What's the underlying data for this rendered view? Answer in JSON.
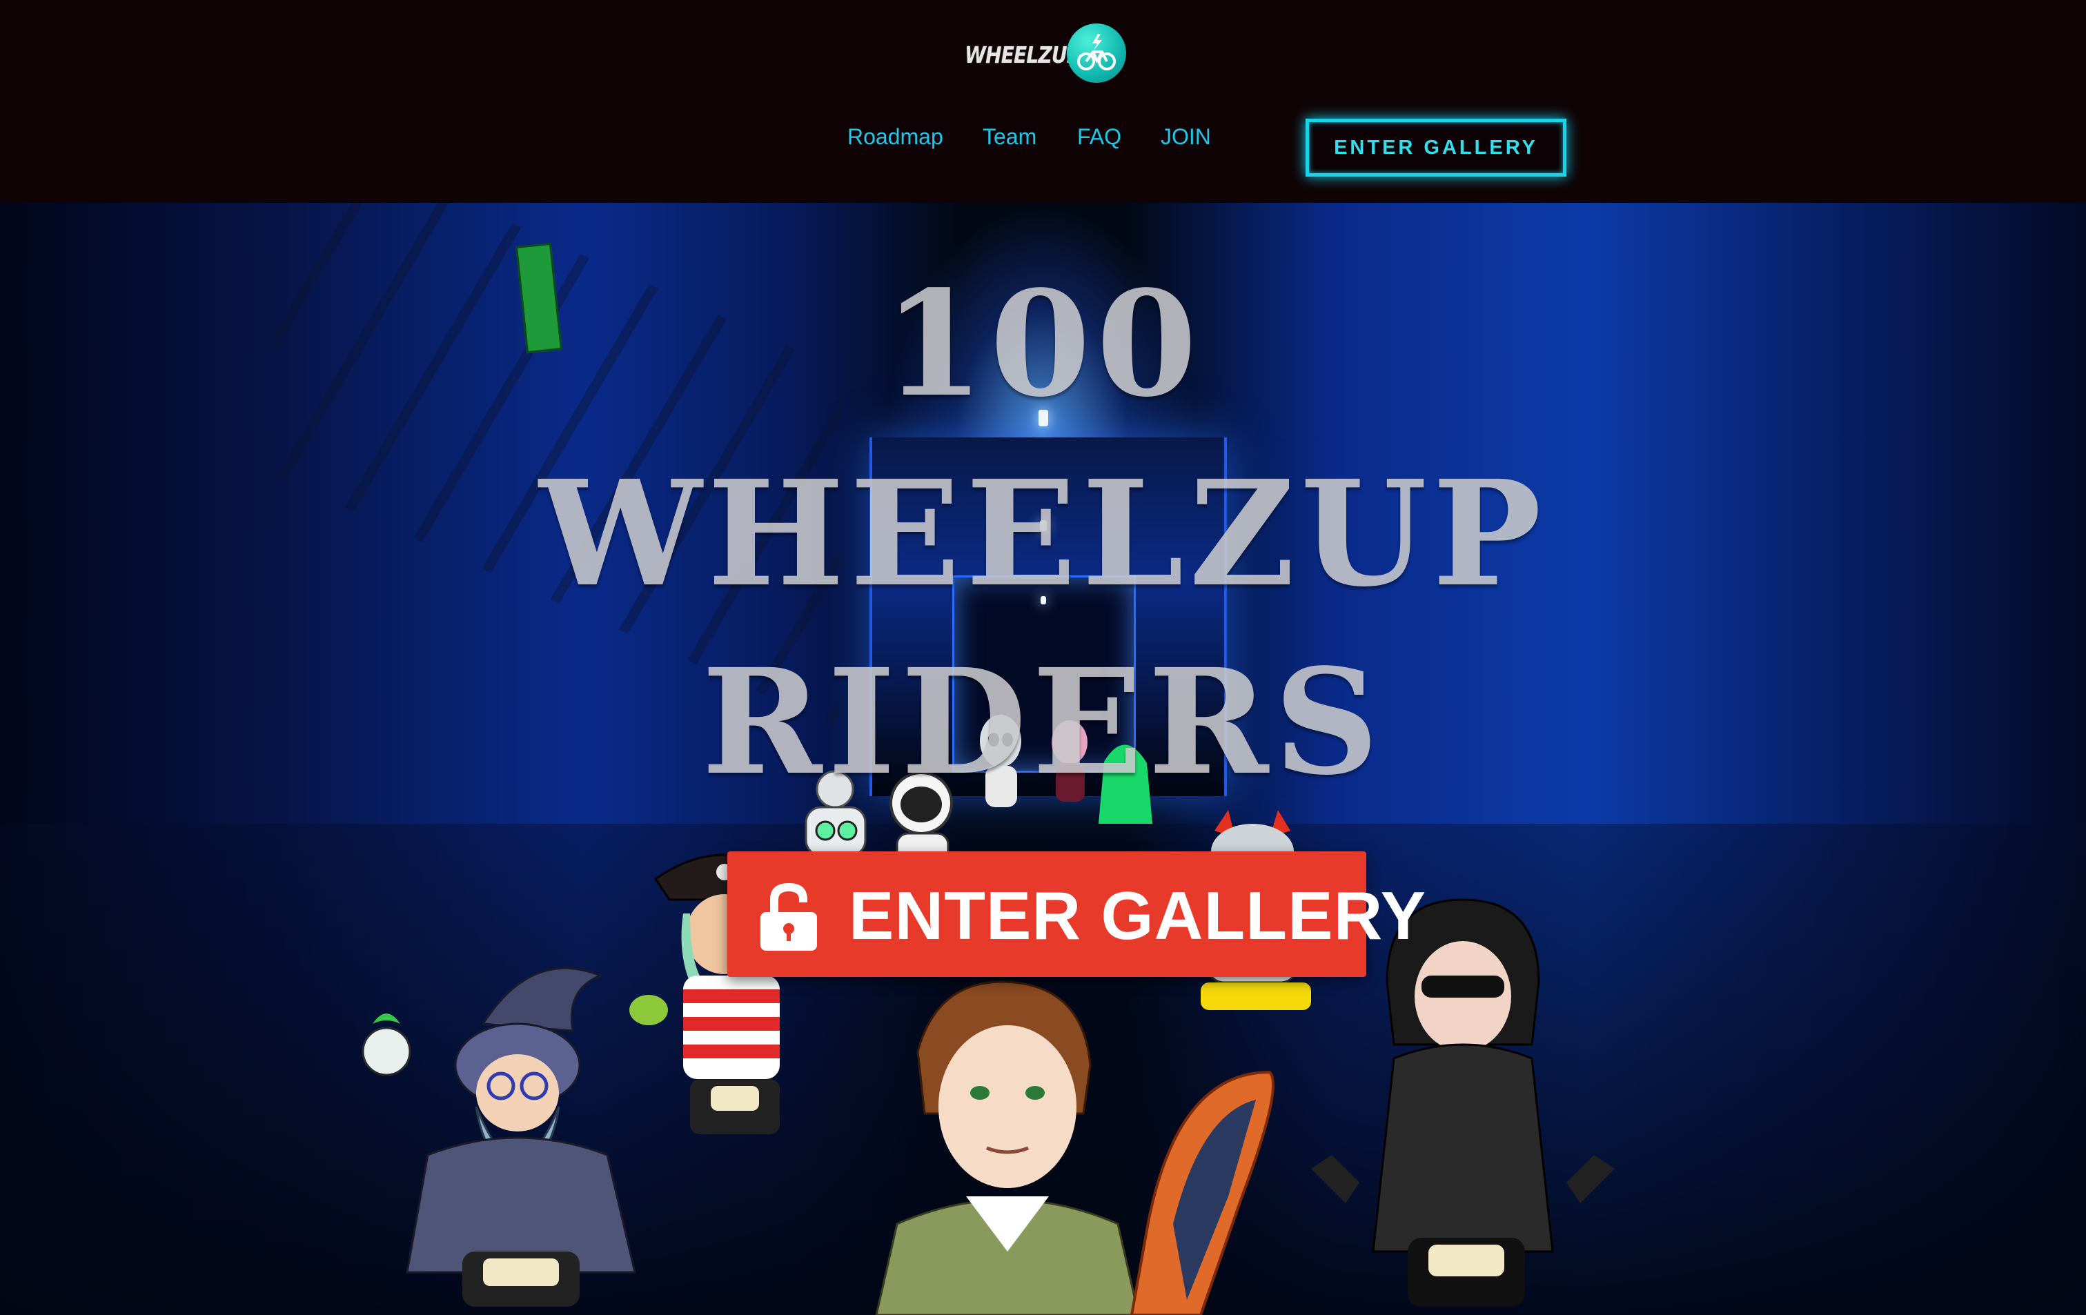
{
  "header": {
    "logo_text": "WHEELZUP",
    "logo_icon": "bicycle-bolt-icon",
    "nav": [
      {
        "label": "Roadmap"
      },
      {
        "label": "Team"
      },
      {
        "label": "FAQ"
      },
      {
        "label": "JOIN"
      }
    ],
    "cta_label": "ENTER GALLERY"
  },
  "hero": {
    "headline_line1": "100",
    "headline_line2": "WHEELZUP",
    "headline_line3": "RIDERS",
    "cta_label": "ENTER GALLERY",
    "cta_icon": "unlock-icon",
    "background": "blue-lit-tunnel",
    "characters": [
      "wizard-rider",
      "pirate-rider",
      "alien-rider",
      "astronaut-rider",
      "green-hair-rider",
      "robot-rider",
      "boy-with-surfboard",
      "masked-rider",
      "vampire-rider"
    ]
  },
  "colors": {
    "header_bg": "#0f0305",
    "nav_link": "#1fc7ea",
    "header_cta_border": "#1ad3e8",
    "hero_cta_bg": "#e73a2b",
    "headline": "#c9c9cc"
  }
}
